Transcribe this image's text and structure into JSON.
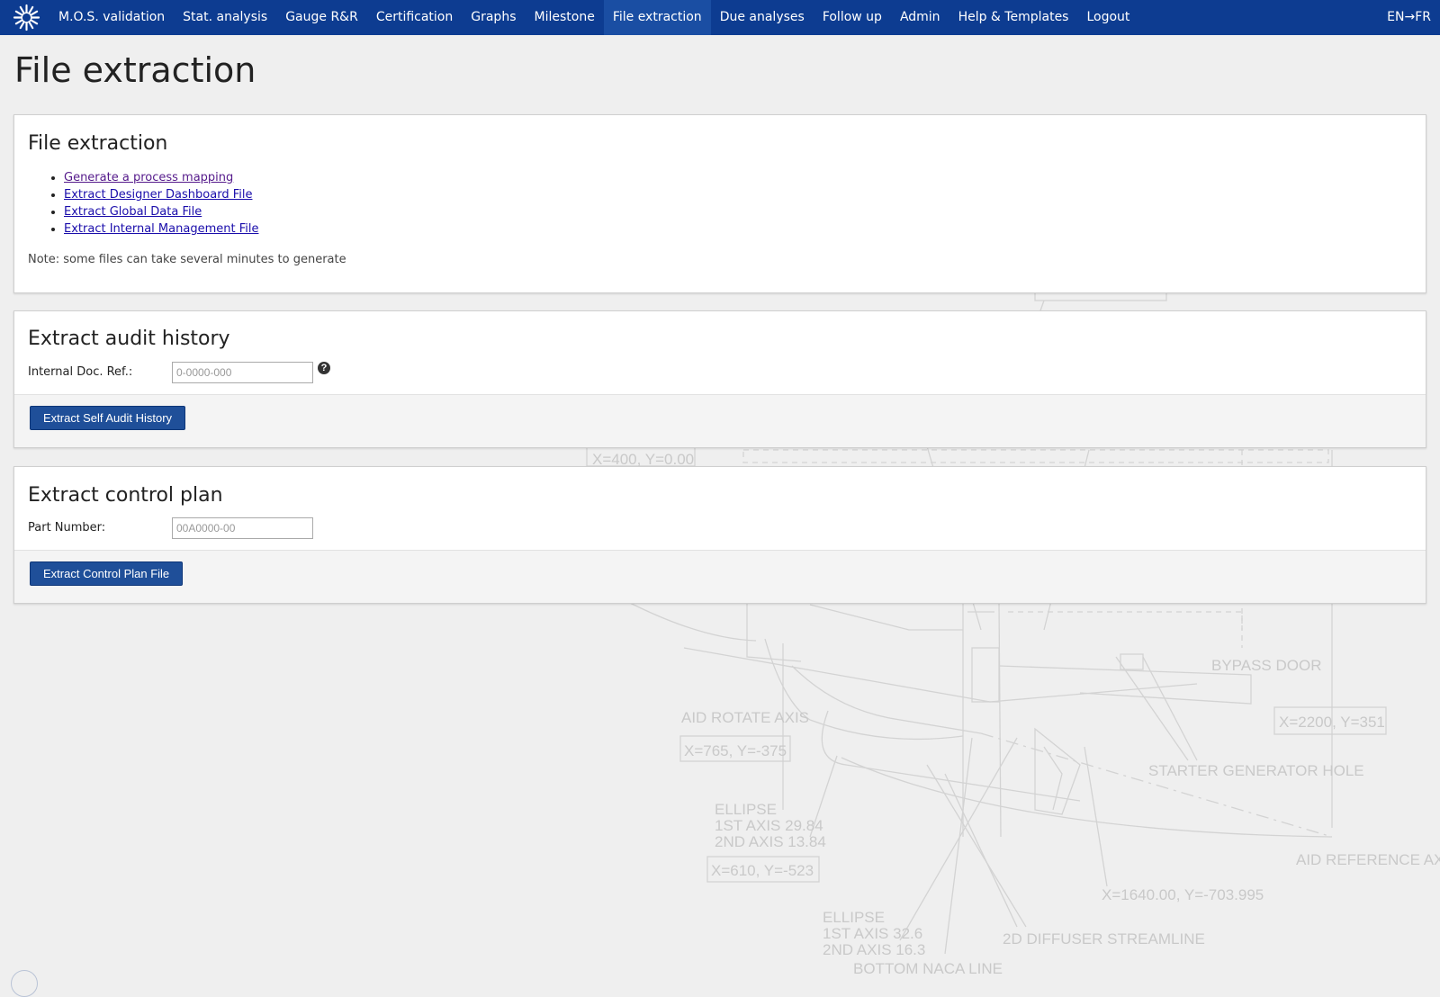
{
  "nav": {
    "items": [
      "M.O.S. validation",
      "Stat. analysis",
      "Gauge R&R",
      "Certification",
      "Graphs",
      "Milestone",
      "File extraction",
      "Due analyses",
      "Follow up",
      "Admin",
      "Help & Templates",
      "Logout"
    ],
    "active_index": 6,
    "language_toggle": "EN→FR"
  },
  "page": {
    "title": "File extraction"
  },
  "file_panel": {
    "title": "File extraction",
    "links": [
      {
        "label": "Generate a process mapping",
        "visited": true
      },
      {
        "label": "Extract Designer Dashboard File",
        "visited": false
      },
      {
        "label": "Extract Global Data File",
        "visited": false
      },
      {
        "label": "Extract Internal Management File",
        "visited": false
      }
    ],
    "note": "Note: some files can take several minutes to generate"
  },
  "audit_panel": {
    "title": "Extract audit history",
    "field_label": "Internal Doc. Ref.:",
    "field_placeholder": "0-0000-000",
    "field_value": "",
    "help_icon": "question-circle-icon",
    "button_label": "Extract Self Audit History"
  },
  "control_panel": {
    "title": "Extract control plan",
    "field_label": "Part Number:",
    "field_placeholder": "00A0000-00",
    "field_value": "",
    "button_label": "Extract Control Plan File"
  },
  "background_drawing": {
    "labels": [
      "X=400, Y=0.00",
      "BYPASS DOOR",
      "X=2200, Y=351",
      "AID ROTATE AXIS",
      "X=765, Y=-375",
      "STARTER GENERATOR HOLE",
      "ELLIPSE",
      "1ST AXIS 29.84",
      "2ND AXIS 13.84",
      "X=610, Y=-523",
      "AID REFERENCE AXIS",
      "X=1640.00, Y=-703.995",
      "ELLIPSE",
      "1ST AXIS 32.6",
      "2ND AXIS 16.3",
      "2D DIFFUSER STREAMLINE",
      "BOTTOM NACA LINE"
    ]
  },
  "colors": {
    "navbar": "#0d3c91",
    "navbar_active": "#1a4ea3",
    "button": "#1f4f99",
    "link": "#1a0dab",
    "link_visited": "#551a8b",
    "background": "#efefef"
  }
}
